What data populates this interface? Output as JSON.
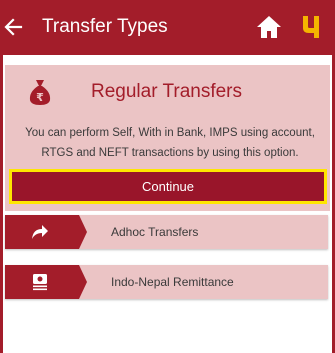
{
  "header": {
    "title": "Transfer Types",
    "back_icon": "arrow-left-icon",
    "home_icon": "home-icon",
    "logo_icon": "bank-logo-icon"
  },
  "regular": {
    "title": "Regular Transfers",
    "description": "You can perform Self, With in Bank, IMPS using account, RTGS and NEFT transactions by using this option.",
    "button_label": "Continue",
    "icon": "money-bag-icon"
  },
  "options": [
    {
      "label": "Adhoc Transfers",
      "icon": "share-arrow-icon"
    },
    {
      "label": "Indo-Nepal Remittance",
      "icon": "remittance-icon"
    }
  ],
  "colors": {
    "primary": "#a31d2a",
    "card_bg": "#ebc4c5",
    "highlight": "#ffe600",
    "logo_yellow": "#f5b400"
  }
}
